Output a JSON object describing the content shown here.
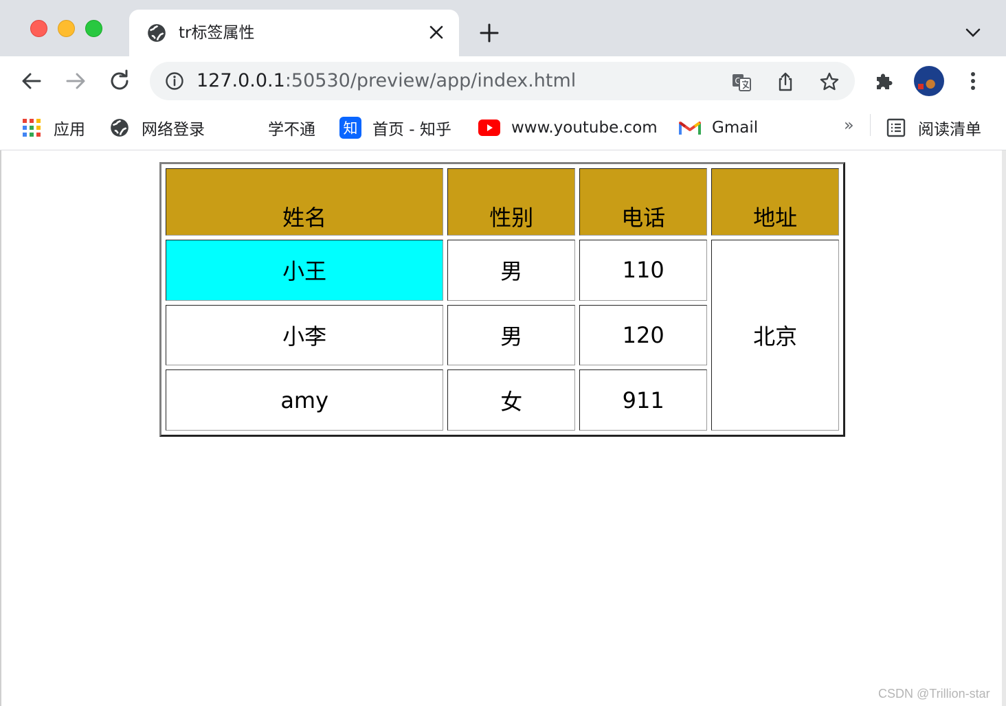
{
  "tab": {
    "title": "tr标签属性"
  },
  "address_bar": {
    "host": "127.0.0.1",
    "path": ":50530/preview/app/index.html"
  },
  "bookmarks": [
    {
      "label": "应用",
      "icon": "apps-grid-icon"
    },
    {
      "label": "网络登录",
      "icon": "globe-icon"
    },
    {
      "label": "学不通",
      "icon": "none"
    },
    {
      "label": "首页 - 知乎",
      "icon": "zhihu-icon"
    },
    {
      "label": "www.youtube.com",
      "icon": "youtube-icon"
    },
    {
      "label": "Gmail",
      "icon": "gmail-icon"
    }
  ],
  "bookmarks_overflow": "»",
  "reading_list": {
    "label": "阅读清单",
    "icon": "reading-list-icon"
  },
  "table": {
    "headers": [
      "姓名",
      "性别",
      "电话",
      "地址"
    ],
    "header_bg": "#c99d16",
    "highlight_bg": "#00ffff",
    "rows": [
      [
        "小王",
        "男",
        "110"
      ],
      [
        "小李",
        "男",
        "120"
      ],
      [
        "amy",
        "女",
        "911"
      ]
    ],
    "merged_address": "北京"
  },
  "watermark": "CSDN @Trillion-star"
}
